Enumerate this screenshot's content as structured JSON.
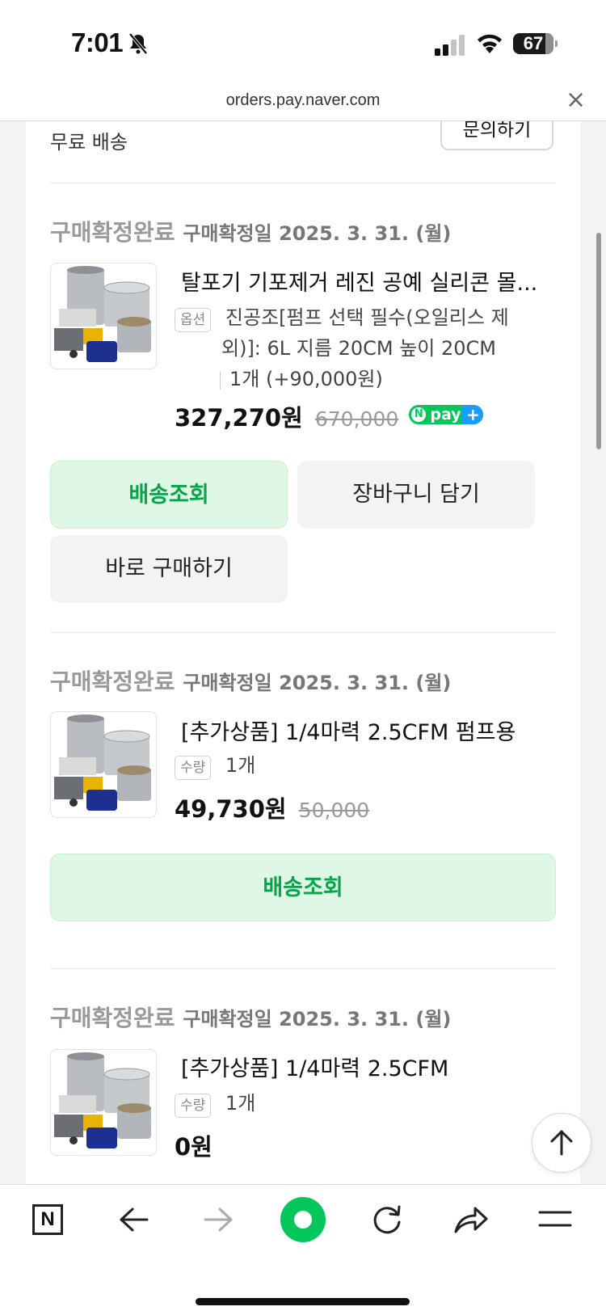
{
  "status_bar": {
    "time": "7:01",
    "battery": "67"
  },
  "browser": {
    "url": "orders.pay.naver.com",
    "close_label": "×"
  },
  "top_partial": {
    "free_shipping": "무료 배송",
    "inquiry_button": "문의하기"
  },
  "orders": [
    {
      "status": "구매확정완료",
      "confirm_date": "구매확정일 2025. 3. 31. (월)",
      "name": "탈포기 기포제거 레진 공예 실리콘 몰...",
      "badge": "옵션",
      "option_line1": "진공조[펌프 선택 필수(오일리스 제",
      "option_line2": "외)]: 6L 지름 20CM 높이 20CM",
      "option_line3": "1개 (+90,000원)",
      "price": "327,270원",
      "original_price": "670,000",
      "npay_label": "pay",
      "buttons": {
        "delivery": "배송조회",
        "cart": "장바구니 담기",
        "buy_now": "바로 구매하기"
      }
    },
    {
      "status": "구매확정완료",
      "confirm_date": "구매확정일 2025. 3. 31. (월)",
      "name": "[추가상품] 1/4마력 2.5CFM 펌프용",
      "badge": "수량",
      "qty": "1개",
      "price": "49,730원",
      "original_price": "50,000",
      "buttons": {
        "delivery": "배송조회"
      }
    },
    {
      "status": "구매확정완료",
      "confirm_date": "구매확정일 2025. 3. 31. (월)",
      "name": "[추가상품] 1/4마력 2.5CFM",
      "badge": "수량",
      "qty": "1개",
      "price": "0원"
    }
  ],
  "nav": {
    "n_logo": "N"
  },
  "icons": [
    "bell-slash-icon",
    "signal-icon",
    "wifi-icon",
    "close-icon",
    "arrow-up-icon",
    "naver-n-icon",
    "back-arrow-icon",
    "forward-arrow-icon",
    "green-dot-icon",
    "refresh-icon",
    "share-icon",
    "menu-icon"
  ]
}
